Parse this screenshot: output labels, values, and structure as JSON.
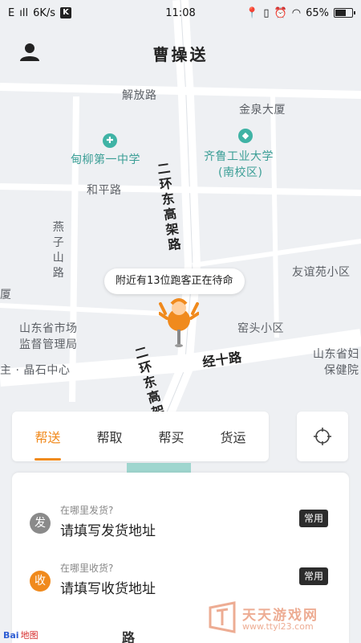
{
  "status_bar": {
    "carrier": "E",
    "signal": "ıll",
    "speed": "6K/s",
    "k_badge": "K",
    "time": "11:08",
    "battery": "65%",
    "battery_level": 0.65
  },
  "header": {
    "title": "曹操送",
    "user_icon": "user-icon"
  },
  "map": {
    "labels": {
      "jiefang_road": "解放路",
      "jinquan": "金泉大厦",
      "school": "甸柳第一中学",
      "qilu_univ": "齐鲁工业大学",
      "qilu_campus": "(南校区)",
      "heping_road": "和平路",
      "second_ring_high": "二环东高架路",
      "yanzi_road": "燕子山路",
      "youyi": "友谊苑小区",
      "xia": "厦",
      "market1": "山东省市场",
      "market2": "监督管理局",
      "yaotou": "窑头小区",
      "jingshi_road": "经十路",
      "jingshi_center": "主 · 晶石中心",
      "health1": "山东省妇",
      "health2": "保健院",
      "second_ring_lower": "二环东高架",
      "top_road": "东 … 路"
    }
  },
  "bubble": {
    "text": "附近有13位跑客正在待命"
  },
  "tabs": [
    {
      "label": "帮送",
      "active": true
    },
    {
      "label": "帮取",
      "active": false
    },
    {
      "label": "帮买",
      "active": false
    },
    {
      "label": "货运",
      "active": false
    }
  ],
  "address": {
    "send": {
      "icon_text": "发",
      "hint": "在哪里发货?",
      "placeholder": "请填写发货地址",
      "fav": "常用",
      "color": "#8a8a8a"
    },
    "receive": {
      "icon_text": "收",
      "hint": "在哪里收货?",
      "placeholder": "请填写收货地址",
      "fav": "常用",
      "color": "#f08a1d"
    }
  },
  "footer": {
    "baidu": "Bai",
    "baidu_map": "地图",
    "road": "路"
  },
  "watermark": {
    "title": "天天游戏网",
    "url": "www.ttyl23.com"
  },
  "colors": {
    "accent": "#f08a1d",
    "teal": "#3fb3a5"
  }
}
